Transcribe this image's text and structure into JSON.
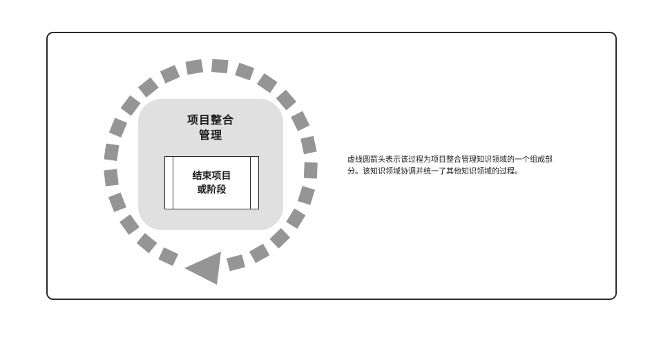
{
  "knowledge_area": {
    "title_line1": "项目整合",
    "title_line2": "管理"
  },
  "process": {
    "label_line1": "结束项目",
    "label_line2": "或阶段"
  },
  "description": "虚线圆箭头表示该过程为项目整合管理知识领域的一个组成部分。该知识领域协调并统一了其他知识领域的过程。",
  "colors": {
    "dash": "#959595",
    "knowledge_area_fill": "#e0e0e0",
    "frame_border": "#2a2a2a"
  },
  "icons": {
    "cycle_arrow": "dashed-circular-arrow-icon"
  }
}
